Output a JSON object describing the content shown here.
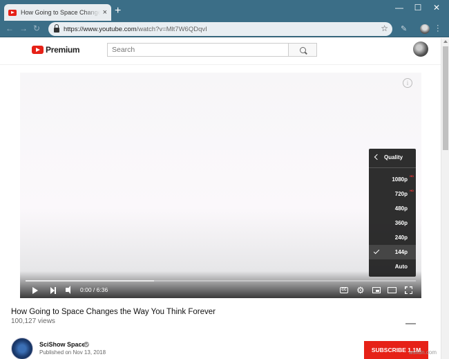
{
  "browser": {
    "tab_title": "How Going to Space Changes the Way You Think Forever",
    "tab_close": "×",
    "new_tab": "+",
    "window_controls": {
      "minimize": "—",
      "maximize": "☐",
      "close": "✕"
    },
    "nav": {
      "back": "←",
      "forward": "→",
      "reload": "↻"
    },
    "url": {
      "base": "https://www.youtube.com",
      "path": "/watch?v=Mlt7W6QDqvI"
    },
    "bookmark_icon": "star-icon"
  },
  "youtube": {
    "logo_text": "Premium",
    "search_placeholder": "Search"
  },
  "player": {
    "time": "0:00 / 6:36",
    "buffered_fraction": 0.33,
    "cc_label": "CC",
    "quality_menu": {
      "title": "Quality",
      "items": [
        {
          "label": "1080p",
          "hd": "HD"
        },
        {
          "label": "720p",
          "hd": "HD"
        },
        {
          "label": "480p",
          "hd": ""
        },
        {
          "label": "360p",
          "hd": ""
        },
        {
          "label": "240p",
          "hd": ""
        },
        {
          "label": "144p",
          "hd": ""
        },
        {
          "label": "Auto",
          "hd": ""
        }
      ],
      "selected": "144p"
    }
  },
  "video": {
    "title": "How Going to Space Changes the Way You Think Forever",
    "views": "100,127 views",
    "channel": "SciShow Space",
    "published": "Published on Nov 13, 2018",
    "subscribe": "SUBSCRIBE 1.1M"
  },
  "watermark": "wsxdn.com",
  "colors": {
    "titlebar": "#3b6e87",
    "youtube_red": "#e62117"
  }
}
